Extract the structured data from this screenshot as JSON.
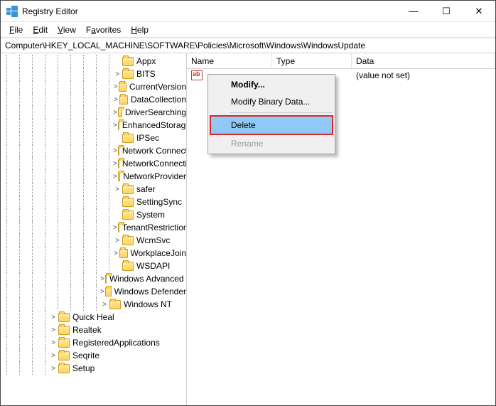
{
  "title": "Registry Editor",
  "winbtns": {
    "min": "—",
    "max": "☐",
    "close": "✕"
  },
  "menu": {
    "file": "File",
    "edit": "Edit",
    "view": "View",
    "favorites": "Favorites",
    "help": "Help"
  },
  "address": "Computer\\HKEY_LOCAL_MACHINE\\SOFTWARE\\Policies\\Microsoft\\Windows\\WindowsUpdate",
  "columns": {
    "name": "Name",
    "type": "Type",
    "data": "Data"
  },
  "value_row": {
    "data": "(value not set)"
  },
  "context": {
    "modify": "Modify...",
    "modify_binary": "Modify Binary Data...",
    "delete": "Delete",
    "rename": "Rename"
  },
  "tree": {
    "items": [
      {
        "depth": 9,
        "exp": "",
        "label": "Appx"
      },
      {
        "depth": 9,
        "exp": ">",
        "label": "BITS"
      },
      {
        "depth": 9,
        "exp": ">",
        "label": "CurrentVersion"
      },
      {
        "depth": 9,
        "exp": ">",
        "label": "DataCollection"
      },
      {
        "depth": 9,
        "exp": ">",
        "label": "DriverSearching"
      },
      {
        "depth": 9,
        "exp": ">",
        "label": "EnhancedStorageDevices"
      },
      {
        "depth": 9,
        "exp": "",
        "label": "IPSec"
      },
      {
        "depth": 9,
        "exp": ">",
        "label": "Network Connections"
      },
      {
        "depth": 9,
        "exp": ">",
        "label": "NetworkConnectivityStatusIndicator"
      },
      {
        "depth": 9,
        "exp": ">",
        "label": "NetworkProvider"
      },
      {
        "depth": 9,
        "exp": ">",
        "label": "safer"
      },
      {
        "depth": 9,
        "exp": "",
        "label": "SettingSync"
      },
      {
        "depth": 9,
        "exp": "",
        "label": "System"
      },
      {
        "depth": 9,
        "exp": ">",
        "label": "TenantRestrictions"
      },
      {
        "depth": 9,
        "exp": ">",
        "label": "WcmSvc"
      },
      {
        "depth": 9,
        "exp": ">",
        "label": "WorkplaceJoin"
      },
      {
        "depth": 9,
        "exp": "",
        "label": "WSDAPI"
      },
      {
        "depth": 8,
        "exp": ">",
        "label": "Windows Advanced Threat Protection"
      },
      {
        "depth": 8,
        "exp": ">",
        "label": "Windows Defender"
      },
      {
        "depth": 8,
        "exp": ">",
        "label": "Windows NT"
      },
      {
        "depth": 4,
        "exp": ">",
        "label": "Quick Heal"
      },
      {
        "depth": 4,
        "exp": ">",
        "label": "Realtek"
      },
      {
        "depth": 4,
        "exp": ">",
        "label": "RegisteredApplications"
      },
      {
        "depth": 4,
        "exp": ">",
        "label": "Seqrite"
      },
      {
        "depth": 4,
        "exp": ">",
        "label": "Setup"
      }
    ]
  }
}
